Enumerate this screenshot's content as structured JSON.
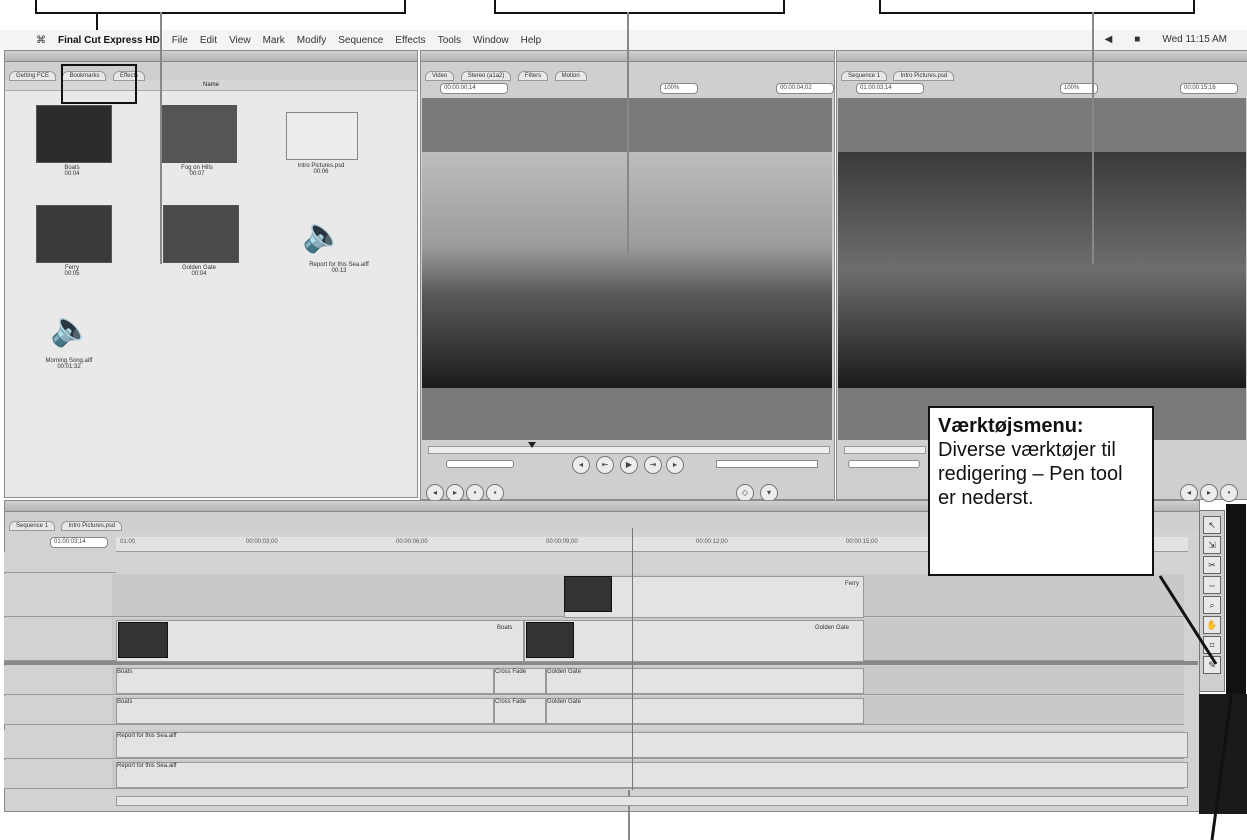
{
  "menubar": {
    "apple": "⌘",
    "app_name": "Final Cut Express HD",
    "items": [
      "File",
      "Edit",
      "View",
      "Mark",
      "Modify",
      "Sequence",
      "Effects",
      "Tools",
      "Window",
      "Help"
    ],
    "clock": "Wed 11:15 AM"
  },
  "browser": {
    "tabs": [
      "Getting FCE",
      "Bookmarks",
      "Effects"
    ],
    "header": "Name",
    "clips": [
      {
        "name": "Boats",
        "duration": "00:04"
      },
      {
        "name": "Fog on Hills",
        "duration": "00:07"
      },
      {
        "name": "Intro Pictures.psd",
        "duration": "00:06"
      },
      {
        "name": "Ferry",
        "duration": "00:05"
      },
      {
        "name": "Golden Gate",
        "duration": "00:04"
      },
      {
        "name": "Report for this Sea.aiff",
        "duration": "00:13"
      },
      {
        "name": "Morning Song.aiff",
        "duration": "00:01:32"
      }
    ]
  },
  "viewer": {
    "tabs": [
      "Video",
      "Stereo (a1a2)",
      "Filters",
      "Motion"
    ],
    "timecode_left": "00:00:00;14",
    "zoom": "100%",
    "timecode_right": "00:00:04;02"
  },
  "canvas": {
    "tabs": [
      "Sequence 1",
      "Intro Pictures.psd"
    ],
    "timecode_left": "01:00:03;14",
    "zoom": "100%",
    "timecode_right": "00:00:15;16"
  },
  "timeline": {
    "tabs": [
      "Sequence 1",
      "Intro Pictures.psd"
    ],
    "timecode": "01:00:03;14",
    "ruler": [
      "01:00",
      "00:00:03;00",
      "00:00:06;00",
      "00:00:09;00",
      "00:00:12;00",
      "00:00:15;00"
    ],
    "clips": {
      "ferry": "Ferry",
      "boats": "Boats",
      "golden_gate": "Golden Gate",
      "cross_fade": "Cross Fade",
      "audio_file": "Report for this Sea.aiff"
    }
  },
  "annotation": {
    "title": "Værktøjsmenu:",
    "body": "Diverse værktøjer til redigering – Pen tool er nederst."
  }
}
